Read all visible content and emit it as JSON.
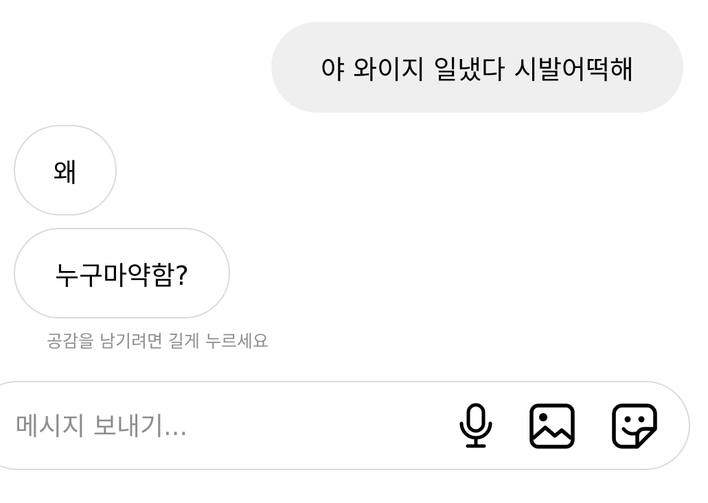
{
  "messages": [
    {
      "direction": "outgoing",
      "text": "야 와이지 일냈다 시발어떡해"
    },
    {
      "direction": "incoming",
      "text": "왜"
    },
    {
      "direction": "incoming",
      "text": "누구마약함?"
    }
  ],
  "reaction_hint": "공감을 남기려면 길게 누르세요",
  "composer": {
    "placeholder": "메시지 보내기...",
    "icons": [
      "microphone-icon",
      "image-icon",
      "sticker-icon"
    ]
  },
  "colors": {
    "outgoing_bubble": "#efefef",
    "incoming_border": "#dbdbdb",
    "hint_text": "#8e8e8e",
    "text": "#000000"
  }
}
